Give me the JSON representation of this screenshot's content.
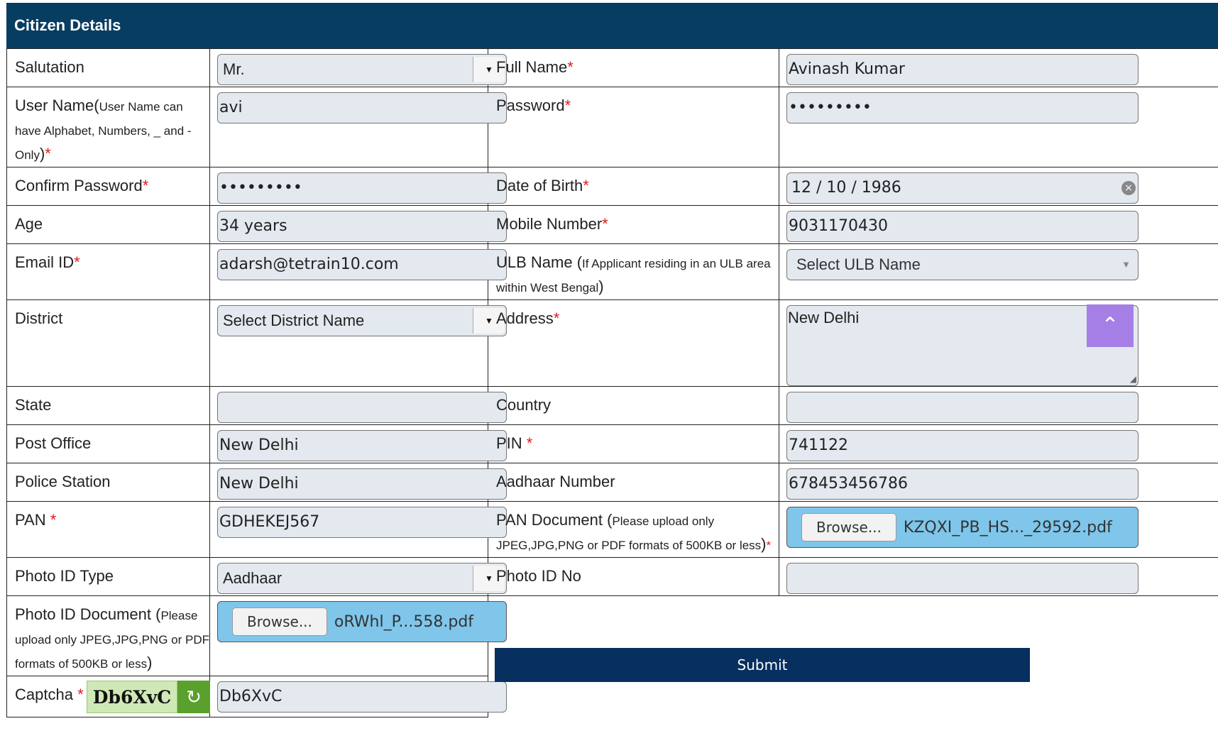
{
  "header": {
    "title": "Citizen Details"
  },
  "labels": {
    "salutation": "Salutation",
    "full_name": "Full Name",
    "user_name": "User Name(",
    "user_name_hint": "User Name can have Alphabet, Numbers, _ and - Only",
    "password": "Password",
    "confirm_password": "Confirm Password",
    "dob": "Date of Birth",
    "age": "Age",
    "mobile": "Mobile Number",
    "email": "Email ID",
    "ulb": "ULB Name (",
    "ulb_hint": "If Applicant residing in an ULB area within West Bengal",
    "district": "District",
    "address": "Address",
    "state": "State",
    "country": "Country",
    "post_office": "Post Office",
    "pin": "PIN ",
    "police_station": "Police Station",
    "aadhaar": "Aadhaar Number",
    "pan": "PAN ",
    "pan_doc": "PAN Document (",
    "pan_doc_hint": "Please upload only JPEG,JPG,PNG or PDF formats of 500KB or less",
    "photo_id_type": "Photo ID Type",
    "photo_id_no": "Photo ID No",
    "photo_id_doc": "Photo ID Document (",
    "photo_id_doc_hint": "Please upload only JPEG,JPG,PNG or PDF formats of 500KB or less",
    "captcha": "Captcha ",
    "required_mark": "*",
    "close_paren": ")"
  },
  "values": {
    "salutation": "Mr.",
    "full_name": "Avinash Kumar",
    "user_name": "avi",
    "password": "•••••••••",
    "confirm_password": "•••••••••",
    "dob": "12 / 10 / 1986",
    "age": "34 years",
    "mobile": "9031170430",
    "email": "adarsh@tetrain10.com",
    "ulb_placeholder": "Select ULB Name",
    "district_placeholder": "Select District Name",
    "address": "New Delhi",
    "state": "",
    "country": "",
    "post_office": "New Delhi",
    "pin": "741122",
    "police_station": "New Delhi",
    "aadhaar": "678453456786",
    "pan": "GDHEKEJ567",
    "pan_doc_file": "KZQXI_PB_HS..._29592.pdf",
    "photo_id_type": "Aadhaar",
    "photo_id_no": "",
    "photo_id_doc_file": "oRWhl_P...558.pdf",
    "captcha_image_text": "Db6XvC",
    "captcha_input": "Db6XvC"
  },
  "buttons": {
    "browse": "Browse...",
    "submit": "Submit"
  },
  "icons": {
    "dropdown": "caret-down-icon",
    "clear": "clear-icon",
    "scroll_top": "chevron-up-icon",
    "refresh": "refresh-icon"
  }
}
